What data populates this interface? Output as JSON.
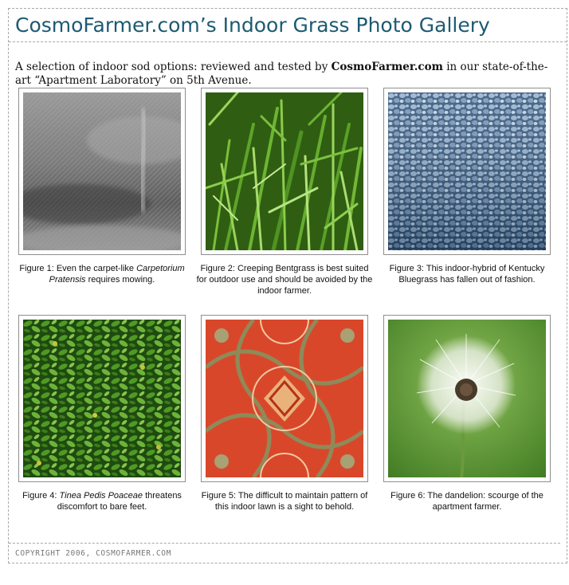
{
  "header": {
    "title": "CosmoFarmer.com’s Indoor Grass Photo Gallery"
  },
  "intro": {
    "before": "A selection of indoor sod options: reviewed and tested by ",
    "brand": "CosmoFarmer.com",
    "after": " in our state-of-the-art “Apartment Laboratory” on 5th Avenue."
  },
  "gallery": {
    "items": [
      {
        "image": "grey-carpet-photo",
        "caption_before": "Figure 1: Even the carpet-like ",
        "caption_italic": "Carpetorium Pratensis",
        "caption_after": " requires mowing."
      },
      {
        "image": "creeping-bentgrass-photo",
        "caption_before": "Figure 2: Creeping Bentgrass is best suited for outdoor use and should be avoided by the indoor farmer.",
        "caption_italic": "",
        "caption_after": ""
      },
      {
        "image": "blue-carpet-photo",
        "caption_before": "Figure 3: This indoor-hybrid of Kentucky Bluegrass has fallen out of fashion.",
        "caption_italic": "",
        "caption_after": ""
      },
      {
        "image": "leafy-ground-cover-photo",
        "caption_before": "Figure 4: ",
        "caption_italic": "Tinea Pedis Poaceae",
        "caption_after": " threatens discomfort to bare feet."
      },
      {
        "image": "patterned-rug-photo",
        "caption_before": "Figure 5: The difficult to maintain pattern of this indoor lawn is a sight to behold.",
        "caption_italic": "",
        "caption_after": ""
      },
      {
        "image": "dandelion-photo",
        "caption_before": "Figure 6: The dandelion: scourge of the apartment farmer.",
        "caption_italic": "",
        "caption_after": ""
      }
    ]
  },
  "footer": {
    "copyright": "COPYRIGHT 2006, COSMOFARMER.COM"
  },
  "colors": {
    "title": "#1d5a72",
    "border": "#a8a8a8",
    "footer_text": "#777777"
  }
}
